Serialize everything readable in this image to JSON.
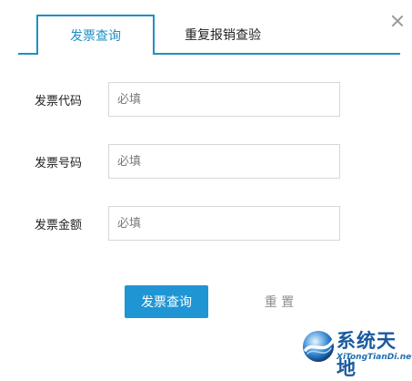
{
  "tabs": [
    {
      "label": "发票查询",
      "active": true
    },
    {
      "label": "重复报销查验",
      "active": false
    }
  ],
  "close": {
    "icon": "close-icon"
  },
  "form": {
    "fields": [
      {
        "label": "发票代码",
        "placeholder": "必填",
        "value": ""
      },
      {
        "label": "发票号码",
        "placeholder": "必填",
        "value": ""
      },
      {
        "label": "发票金额",
        "placeholder": "必填",
        "value": ""
      }
    ]
  },
  "actions": {
    "query_label": "发票查询",
    "reset_label": "重 置"
  },
  "watermark": {
    "title": "系统天地",
    "subtitle": "XiTongTianDi.net"
  },
  "colors": {
    "accent": "#1f8fc5",
    "primary_button": "#1f96d3",
    "reset_text": "#8e8e8e",
    "border": "#d7d7d7"
  }
}
